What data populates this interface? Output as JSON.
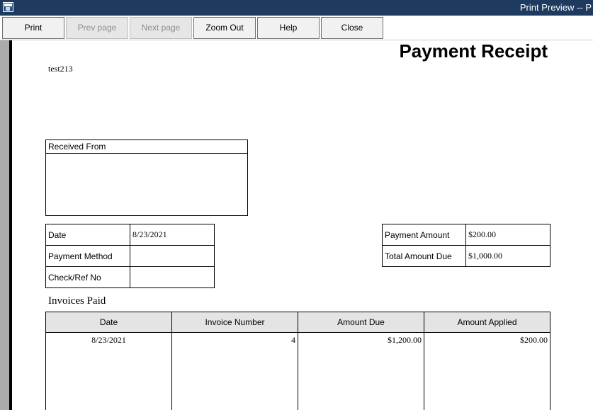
{
  "window": {
    "title": "Print Preview -- P"
  },
  "toolbar": {
    "print": "Print",
    "prev_page": "Prev page",
    "next_page": "Next page",
    "zoom_out": "Zoom Out",
    "help": "Help",
    "close": "Close"
  },
  "receipt": {
    "title": "Payment Receipt",
    "company": "test213",
    "received_from_label": "Received From",
    "left": {
      "date_label": "Date",
      "date_value": "8/23/2021",
      "method_label": "Payment Method",
      "method_value": "",
      "ref_label": "Check/Ref No",
      "ref_value": ""
    },
    "right": {
      "amount_label": "Payment Amount",
      "amount_value": "$200.00",
      "total_due_label": "Total Amount Due",
      "total_due_value": "$1,000.00"
    },
    "invoices_title": "Invoices Paid",
    "invoices": {
      "headers": [
        "Date",
        "Invoice Number",
        "Amount Due",
        "Amount Applied"
      ],
      "rows": [
        {
          "date": "8/23/2021",
          "number": "4",
          "amount_due": "$1,200.00",
          "amount_applied": "$200.00"
        }
      ]
    }
  },
  "colors": {
    "titlebar": "#1e3a5f",
    "preview_bg": "#ababab",
    "header_fill": "#e4e4e4"
  }
}
